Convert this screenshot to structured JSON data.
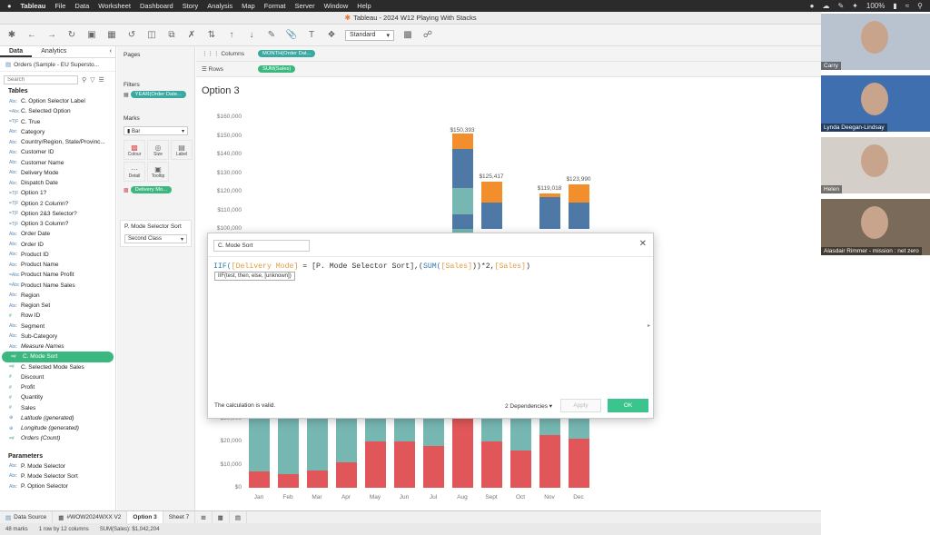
{
  "mac_menu": {
    "apple": "",
    "items": [
      "Tableau",
      "File",
      "Data",
      "Worksheet",
      "Dashboard",
      "Story",
      "Analysis",
      "Map",
      "Format",
      "Server",
      "Window",
      "Help"
    ],
    "battery": "100%"
  },
  "window": {
    "title": "Tableau - 2024 W12 Playing With Stacks"
  },
  "toolbar": {
    "standard": "Standard"
  },
  "data_pane": {
    "tab_data": "Data",
    "tab_analytics": "Analytics",
    "datasource": "Orders (Sample - EU Supersto...",
    "search_placeholder": "Search",
    "tables_header": "Tables",
    "fields": [
      {
        "type": "Abc",
        "name": "C. Option Selector Label"
      },
      {
        "type": "=Abc",
        "name": "C. Selected Option"
      },
      {
        "type": "=T|F",
        "name": "C. True"
      },
      {
        "type": "Abc",
        "name": "Category"
      },
      {
        "type": "Abc",
        "name": "Country/Region, State/Provinc..."
      },
      {
        "type": "Abc",
        "name": "Customer ID"
      },
      {
        "type": "Abc",
        "name": "Customer Name"
      },
      {
        "type": "Abc",
        "name": "Delivery Mode"
      },
      {
        "type": "Abc",
        "name": "Dispatch Date"
      },
      {
        "type": "=T|F",
        "name": "Option 1?"
      },
      {
        "type": "=T|F",
        "name": "Option 2 Column?"
      },
      {
        "type": "=T|F",
        "name": "Option 2&3 Selector?"
      },
      {
        "type": "=T|F",
        "name": "Option 3 Column?"
      },
      {
        "type": "Abc",
        "name": "Order Date"
      },
      {
        "type": "Abc",
        "name": "Order ID"
      },
      {
        "type": "Abc",
        "name": "Product ID"
      },
      {
        "type": "Abc",
        "name": "Product Name"
      },
      {
        "type": "=Abc",
        "name": "Product Name Profit"
      },
      {
        "type": "=Abc",
        "name": "Product Name Sales"
      },
      {
        "type": "Abc",
        "name": "Region"
      },
      {
        "type": "Abc",
        "name": "Region Set"
      },
      {
        "type": "#",
        "name": "Row ID"
      },
      {
        "type": "Abc",
        "name": "Segment"
      },
      {
        "type": "Abc",
        "name": "Sub-Category"
      },
      {
        "type": "Abc",
        "name": "Measure Names",
        "italic": true
      },
      {
        "type": "=#",
        "name": "C. Mode Sort",
        "highlight": true
      },
      {
        "type": "=#",
        "name": "C. Selected Mode Sales"
      },
      {
        "type": "#",
        "name": "Discount"
      },
      {
        "type": "#",
        "name": "Profit"
      },
      {
        "type": "#",
        "name": "Quantity"
      },
      {
        "type": "#",
        "name": "Sales"
      },
      {
        "type": "⊕",
        "name": "Latitude (generated)",
        "italic": true
      },
      {
        "type": "⊕",
        "name": "Longitude (generated)",
        "italic": true
      },
      {
        "type": "=#",
        "name": "Orders (Count)",
        "italic": true
      }
    ],
    "params_header": "Parameters",
    "parameters": [
      {
        "type": "Abc",
        "name": "P. Mode Selector"
      },
      {
        "type": "Abc",
        "name": "P. Mode Selector Sort"
      },
      {
        "type": "Abc",
        "name": "P. Option Selector"
      }
    ]
  },
  "cards": {
    "pages": "Pages",
    "filters": "Filters",
    "filter_pill": "YEAR(Order Date...",
    "marks": "Marks",
    "mark_type": "Bar",
    "mark_buttons": [
      "Colour",
      "Size",
      "Label",
      "Detail",
      "Tooltip"
    ],
    "marks_pill": "Delivery Mo...",
    "param_title": "P. Mode Selector Sort",
    "param_value": "Second Class"
  },
  "shelves": {
    "columns_label": "Columns",
    "columns_pill": "MONTH(Order Dat...",
    "rows_label": "Rows",
    "rows_pill": "SUM(Sales)"
  },
  "view": {
    "title": "Option 3"
  },
  "chart_data": {
    "type": "bar",
    "stacked": true,
    "categories": [
      "Jan",
      "Feb",
      "Mar",
      "Apr",
      "May",
      "Jun",
      "Jul",
      "Aug",
      "Sept",
      "Oct",
      "Nov",
      "Dec"
    ],
    "ylim": [
      0,
      160000
    ],
    "yticks": [
      "$0",
      "$10,000",
      "$20,000",
      "$30,000",
      "$100,000",
      "$110,000",
      "$120,000",
      "$130,000",
      "$140,000",
      "$150,000",
      "$160,000"
    ],
    "colors": [
      "#e15759",
      "#76b7b2",
      "#4e79a7",
      "#f28e2b"
    ],
    "series": [
      {
        "values": [
          7000,
          6000,
          7500,
          11000,
          20000,
          20000,
          18000,
          60000,
          20000,
          16000,
          23000,
          21500
        ]
      },
      {
        "values": [
          23000,
          24000,
          23000,
          19000,
          10000,
          10000,
          12000,
          40000,
          10000,
          14000,
          7000,
          8500
        ]
      },
      {
        "values": [
          0,
          0,
          0,
          0,
          0,
          0,
          0,
          28000,
          0,
          0,
          0,
          0
        ]
      },
      {
        "values": [
          0,
          0,
          0,
          0,
          0,
          0,
          0,
          23000,
          0,
          0,
          0,
          0
        ]
      }
    ],
    "data_labels": [
      {
        "category": "Aug",
        "label": "$150,393"
      },
      {
        "category": "Sept",
        "label": "$125,417"
      },
      {
        "category": "Nov",
        "label": "$119,018"
      },
      {
        "category": "Dec",
        "label": "$123,990"
      }
    ]
  },
  "calc_dialog": {
    "name": "C. Mode Sort",
    "formula_parts": [
      {
        "t": "IIF(",
        "c": "kw"
      },
      {
        "t": "[Delivery Mode]",
        "c": "fld"
      },
      {
        "t": " = [P. Mode Selector Sort],(",
        "c": ""
      },
      {
        "t": "SUM(",
        "c": "kw"
      },
      {
        "t": "[Sales]",
        "c": "fld"
      },
      {
        "t": "))*2,",
        "c": ""
      },
      {
        "t": "[Sales]",
        "c": "fld"
      },
      {
        "t": ")",
        "c": ""
      }
    ],
    "tooltip": "IIF(test, then, else, [unknown])",
    "status": "The calculation is valid.",
    "dependencies": "2 Dependencies ▾",
    "apply": "Apply",
    "ok": "OK"
  },
  "sheet_tabs": [
    "Data Source",
    "#WOW2024WXX V2",
    "Option 3",
    "Sheet 7"
  ],
  "status_bar": {
    "marks": "48 marks",
    "dims": "1 row by 12 columns",
    "sum": "SUM(Sales): $1,042,204"
  },
  "participants": [
    {
      "name": "Carry",
      "bg": "#b9c2cf"
    },
    {
      "name": "Lynda Deegan-Lindsay",
      "bg": "#3f6fae"
    },
    {
      "name": "Helen",
      "bg": "#d4cfc8"
    },
    {
      "name": "Alasdair Rimmer - mission : net zero",
      "bg": "#7a6a5a"
    }
  ]
}
